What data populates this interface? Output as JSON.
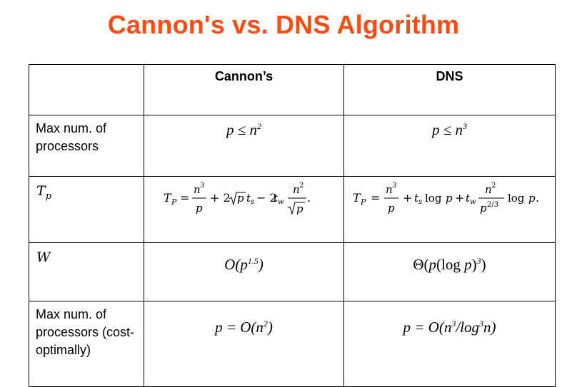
{
  "title": "Cannon's vs. DNS Algorithm",
  "columns": {
    "cannon": "Cannon’s",
    "dns": "DNS"
  },
  "rows": {
    "max_processors": {
      "label": "Max num. of processors",
      "cannon": "p ≤ n^2",
      "dns": "p ≤ n^3"
    },
    "tp": {
      "label": "T_p",
      "cannon": "T_P = n^3/p + 2√p t_s + 2t_w n^2/√p.",
      "dns": "T_P = n^3/p + t_s log p + t_w n^2/p^{2/3} log p."
    },
    "w": {
      "label": "W",
      "cannon": "O(p^1.5)",
      "dns": "Θ(p(log p)^3)"
    },
    "cost_optimal": {
      "label": "Max num. of processors (cost-optimally)",
      "cannon": "p = O(n^2)",
      "dns": "p = O(n^3/log^3n)"
    }
  }
}
